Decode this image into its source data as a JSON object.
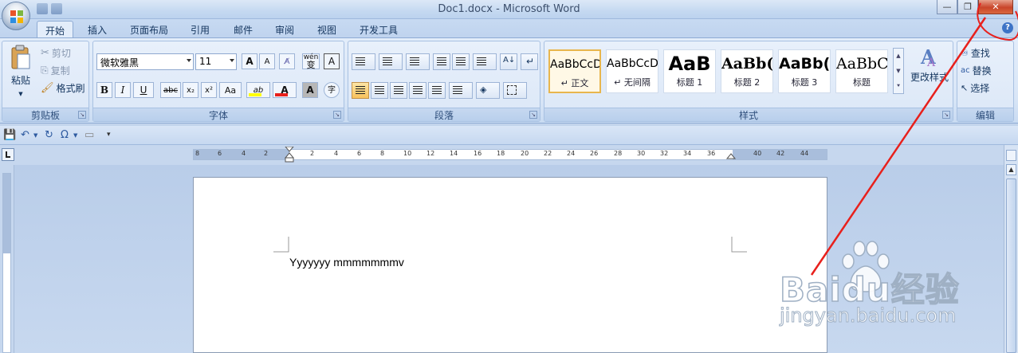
{
  "window": {
    "title": "Doc1.docx - Microsoft Word",
    "controls": [
      "minimize",
      "restore",
      "close"
    ]
  },
  "tabs": [
    "开始",
    "插入",
    "页面布局",
    "引用",
    "邮件",
    "审阅",
    "视图",
    "开发工具"
  ],
  "active_tab": "开始",
  "clipboard": {
    "paste": "粘贴",
    "cut": "剪切",
    "copy": "复制",
    "format_painter": "格式刷",
    "label": "剪贴板"
  },
  "font": {
    "family": "微软雅黑",
    "size": "11",
    "grow": "A",
    "shrink": "A",
    "phonetic": "wén",
    "phonetic_char": "变",
    "border_char": "A",
    "bold": "B",
    "italic": "I",
    "underline": "U",
    "strike": "abc",
    "subscript": "x₂",
    "superscript": "x²",
    "change_case": "Aa",
    "highlight": "ab",
    "font_color": "A",
    "shading": "A",
    "enclose": "字",
    "label": "字体"
  },
  "paragraph": {
    "label": "段落"
  },
  "styles": {
    "items": [
      {
        "sample": "AaBbCcD",
        "name": "↵ 正文"
      },
      {
        "sample": "AaBbCcD",
        "name": "↵ 无间隔"
      },
      {
        "sample": "AaB",
        "name": "标题 1"
      },
      {
        "sample": "AaBb(",
        "name": "标题 2"
      },
      {
        "sample": "AaBb(",
        "name": "标题 3"
      },
      {
        "sample": "AaBbC",
        "name": "标题"
      }
    ],
    "change_styles": "更改样式",
    "label": "样式"
  },
  "editing": {
    "find": "查找",
    "replace": "替换",
    "select": "选择",
    "label": "编辑"
  },
  "ruler": {
    "ticks": [
      "8",
      "6",
      "4",
      "2",
      "2",
      "4",
      "6",
      "8",
      "10",
      "12",
      "14",
      "16",
      "18",
      "20",
      "22",
      "24",
      "26",
      "28",
      "30",
      "32",
      "34",
      "36",
      "40",
      "42",
      "44"
    ]
  },
  "document": {
    "text": "Yyyyyyy mmmmmmmv"
  },
  "watermark": {
    "brand": "Baidu经验",
    "url": "jingyan.baidu.com"
  },
  "colors": {
    "annotation": "#e8201c",
    "highlight_yellow": "#ffff00",
    "font_red": "#e8201c",
    "accent": "#2d5aa0"
  }
}
